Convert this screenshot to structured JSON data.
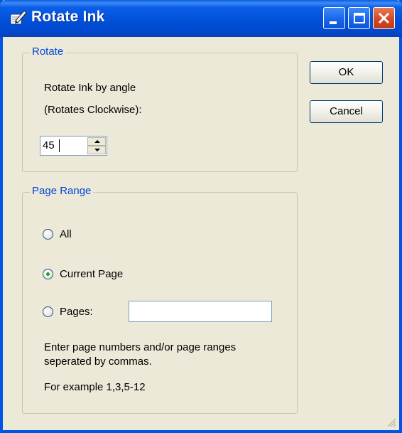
{
  "window": {
    "title": "Rotate Ink",
    "title_icon": "pen-edit-icon",
    "controls": [
      "minimize-icon",
      "maximize-icon",
      "close-icon"
    ]
  },
  "rotate_group": {
    "legend": "Rotate",
    "line1": "Rotate Ink by angle",
    "line2": "(Rotates Clockwise):",
    "angle_value": "45"
  },
  "page_range_group": {
    "legend": "Page Range",
    "options": [
      {
        "label": "All",
        "selected": false
      },
      {
        "label": "Current Page",
        "selected": true
      },
      {
        "label": "Pages:",
        "selected": false
      }
    ],
    "pages_input_value": "",
    "help_line1": "Enter page numbers and/or page ranges",
    "help_line2": "seperated by commas.",
    "example": "For example 1,3,5-12"
  },
  "buttons": {
    "ok": "OK",
    "cancel": "Cancel"
  },
  "colors": {
    "title_bar": "#0150d8",
    "group_legend": "#0046d5",
    "window_face": "#ece9d8",
    "close_button": "#d24a24"
  }
}
